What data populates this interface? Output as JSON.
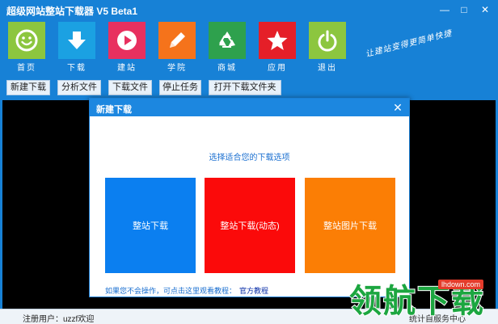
{
  "window": {
    "title": "超级网站整站下载器 V5 Beta1",
    "minimize_glyph": "—",
    "maximize_glyph": "□",
    "close_glyph": "✕"
  },
  "nav": {
    "items": [
      {
        "label": "首页",
        "color": "#8cc63f",
        "icon": "smiley-icon"
      },
      {
        "label": "下载",
        "color": "#1ba1e2",
        "icon": "download-arrow-icon"
      },
      {
        "label": "建站",
        "color": "#e8305f",
        "icon": "play-icon"
      },
      {
        "label": "学院",
        "color": "#f5731b",
        "icon": "pencil-icon"
      },
      {
        "label": "商城",
        "color": "#2ea14d",
        "icon": "recycle-icon"
      },
      {
        "label": "应用",
        "color": "#e51f28",
        "icon": "star-icon"
      },
      {
        "label": "退出",
        "color": "#8cc63f",
        "icon": "power-icon"
      }
    ],
    "slogan": "让建站变得更简单快捷"
  },
  "toolbar": {
    "buttons": [
      "新建下载",
      "分析文件",
      "下载文件",
      "停止任务",
      "打开下载文件夹"
    ]
  },
  "status": {
    "left": "注册用户：uzzf欢迎",
    "right": "统计自服务中心"
  },
  "dialog": {
    "title": "新建下载",
    "close_glyph": "✕",
    "subtitle": "选择适合您的下载选项",
    "options": [
      {
        "label": "整站下载",
        "color": "#0b7ff0"
      },
      {
        "label": "整站下载(动态)",
        "color": "#fb0a0a"
      },
      {
        "label": "整站图片下载",
        "color": "#fb7e05"
      }
    ],
    "help_text": "如果您不会操作，可点击这里观看教程：",
    "help_link": "官方教程"
  },
  "watermark": {
    "text": "领航下载",
    "url": "lhdown.com"
  }
}
